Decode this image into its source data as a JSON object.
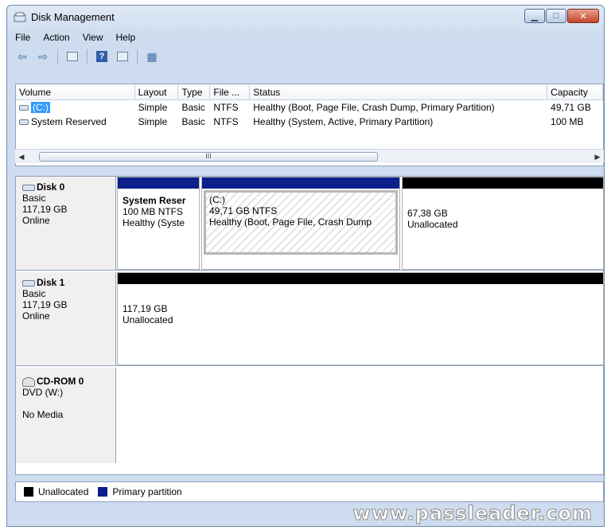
{
  "window": {
    "title": "Disk Management"
  },
  "menu": [
    "File",
    "Action",
    "View",
    "Help"
  ],
  "columns": [
    "Volume",
    "Layout",
    "Type",
    "File ...",
    "Status",
    "Capacity"
  ],
  "volumes": [
    {
      "volume": "(C:)",
      "layout": "Simple",
      "type": "Basic",
      "fs": "NTFS",
      "status": "Healthy (Boot, Page File, Crash Dump, Primary Partition)",
      "capacity": "49,71 GB"
    },
    {
      "volume": "System Reserved",
      "layout": "Simple",
      "type": "Basic",
      "fs": "NTFS",
      "status": "Healthy (System, Active, Primary Partition)",
      "capacity": "100 MB"
    }
  ],
  "scroll_thumb": "III",
  "disks": {
    "disk0": {
      "name": "Disk 0",
      "kind": "Basic",
      "size": "117,19 GB",
      "state": "Online",
      "partitions": [
        {
          "title": "System Reser",
          "detail": "100 MB NTFS",
          "status": "Healthy (Syste"
        },
        {
          "title": "(C:)",
          "detail": "49,71 GB NTFS",
          "status": "Healthy (Boot, Page File, Crash Dump"
        },
        {
          "detail": "67,38 GB",
          "status": "Unallocated"
        }
      ]
    },
    "disk1": {
      "name": "Disk 1",
      "kind": "Basic",
      "size": "117,19 GB",
      "state": "Online",
      "partitions": [
        {
          "detail": "117,19 GB",
          "status": "Unallocated"
        }
      ]
    },
    "cdrom0": {
      "name": "CD-ROM 0",
      "kind": "DVD (W:)",
      "state": "No Media"
    }
  },
  "legend": {
    "unallocated": "Unallocated",
    "primary": "Primary partition"
  },
  "colors": {
    "unallocated": "#000000",
    "primary": "#0c1f8a",
    "selection": "#3399ff"
  },
  "watermark": "www.passleader.com"
}
